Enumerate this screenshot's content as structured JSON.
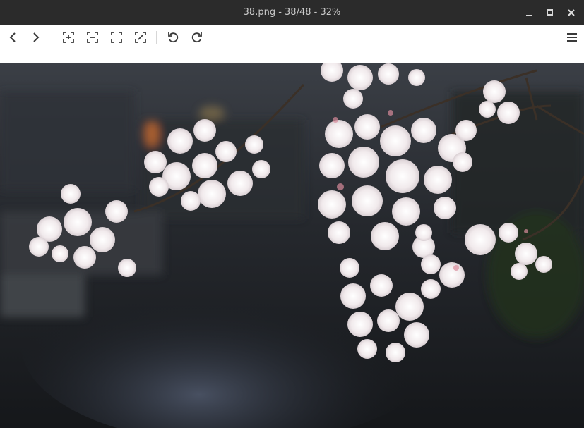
{
  "window": {
    "title": "38.png - 38/48 - 32%",
    "controls": [
      "minimize-icon",
      "maximize-icon",
      "close-icon"
    ]
  },
  "toolbar": {
    "buttons": [
      {
        "name": "previous-image-button",
        "icon": "chevron-left-icon"
      },
      {
        "name": "next-image-button",
        "icon": "chevron-right-icon"
      },
      {
        "name": "zoom-in-button",
        "icon": "zoom-in-icon"
      },
      {
        "name": "zoom-out-button",
        "icon": "zoom-out-icon"
      },
      {
        "name": "fit-to-window-button",
        "icon": "fit-window-icon"
      },
      {
        "name": "original-size-button",
        "icon": "original-size-icon"
      },
      {
        "name": "rotate-left-button",
        "icon": "rotate-ccw-icon"
      },
      {
        "name": "rotate-right-button",
        "icon": "rotate-cw-icon"
      },
      {
        "name": "menu-button",
        "icon": "hamburger-menu-icon"
      }
    ]
  },
  "image": {
    "subject": "cherry blossoms over canal photo",
    "colors": {
      "background": "#1c1e21",
      "petal": "#f4eef0",
      "water": "#2e3440"
    }
  }
}
